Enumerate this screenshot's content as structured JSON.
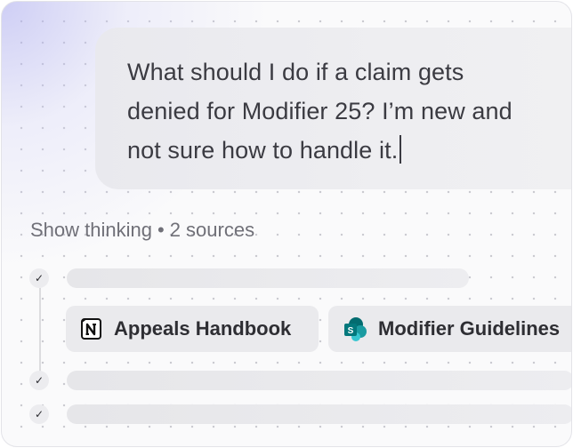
{
  "prompt": {
    "text": "What should I do if a claim gets denied for Modifier 25? I’m new and not sure how to handle it."
  },
  "thinking": {
    "label": "Show thinking",
    "separator": "•",
    "sources_label": "2 sources"
  },
  "sources": [
    {
      "label": "Appeals Handbook",
      "icon": "notion-icon"
    },
    {
      "label": "Modifier Guidelines",
      "icon": "sharepoint-icon"
    }
  ],
  "steps": [
    {
      "status": "done",
      "icon": "check-icon"
    },
    {
      "status": "done",
      "icon": "check-icon"
    },
    {
      "status": "done",
      "icon": "check-icon"
    }
  ],
  "colors": {
    "accent_glow": "#aaaaf0",
    "sharepoint": "#038387"
  }
}
